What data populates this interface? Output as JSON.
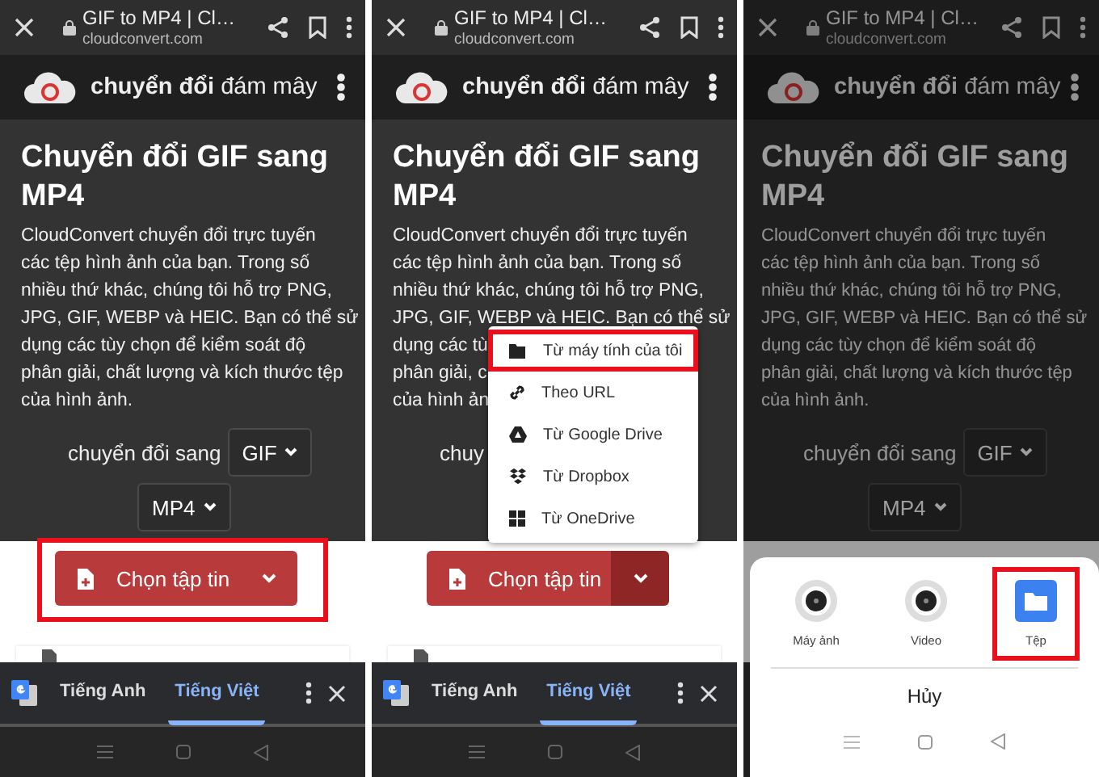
{
  "panels": [
    {
      "browser": {
        "title": "GIF to MP4 | Cl…",
        "url": "cloudconvert.com"
      },
      "brand": {
        "bold": "chuyển đổi",
        "rest": "đám mây"
      },
      "heading": [
        "Chuyển đổi GIF sang",
        "MP4"
      ],
      "paragraph": [
        "CloudConvert chuyển đổi trực tuyến",
        "các tệp hình ảnh của bạn. Trong số",
        "nhiều thứ khác, chúng tôi hỗ trợ PNG,",
        "JPG, GIF, WEBP và HEIC. Bạn có thể sử",
        "dụng các tùy chọn để kiểm soát độ",
        "phân giải, chất lượng và kích thước tệp",
        "của hình ảnh."
      ],
      "convert": {
        "label": "chuyển đổi sang",
        "from": "GIF",
        "to": "MP4"
      },
      "upload": {
        "label": "Chọn tập tin",
        "highlighted": true,
        "split_open": false
      },
      "translate_bar": {
        "languages": [
          {
            "label": "Tiếng Anh",
            "selected": false
          },
          {
            "label": "Tiếng Việt",
            "selected": true
          }
        ]
      }
    },
    {
      "browser": {
        "title": "GIF to MP4 | Cl…",
        "url": "cloudconvert.com"
      },
      "brand": {
        "bold": "chuyển đổi",
        "rest": "đám mây"
      },
      "heading": [
        "Chuyển đổi GIF sang",
        "MP4"
      ],
      "paragraph": [
        "CloudConvert chuyển đổi trực tuyến",
        "các tệp hình ảnh của bạn. Trong số",
        "nhiều thứ khác, chúng tôi hỗ trợ PNG,",
        "JPG, GIF, WEBP và HEIC. Bạn có thể sử",
        "dụng các tù",
        "phân giải, c",
        "của hình ản"
      ],
      "convert": {
        "label": "chuy"
      },
      "upload": {
        "label": "Chọn tập tin",
        "highlighted": false,
        "split_open": true
      },
      "menu": [
        {
          "label": "Từ máy tính của tôi",
          "highlighted": true
        },
        {
          "label": "Theo URL",
          "highlighted": false
        },
        {
          "label": "Từ Google Drive",
          "highlighted": false
        },
        {
          "label": "Từ Dropbox",
          "highlighted": false
        },
        {
          "label": "Từ OneDrive",
          "highlighted": false
        }
      ],
      "translate_bar": {
        "languages": [
          {
            "label": "Tiếng Anh",
            "selected": false
          },
          {
            "label": "Tiếng Việt",
            "selected": true
          }
        ]
      }
    },
    {
      "dimmed": true,
      "browser": {
        "title": "GIF to MP4 | Cl…",
        "url": "cloudconvert.com"
      },
      "brand": {
        "bold": "chuyển đổi",
        "rest": "đám mây"
      },
      "heading": [
        "Chuyển đổi GIF sang",
        "MP4"
      ],
      "paragraph": [
        "CloudConvert chuyển đổi trực tuyến",
        "các tệp hình ảnh của bạn. Trong số",
        "nhiều thứ khác, chúng tôi hỗ trợ PNG,",
        "JPG, GIF, WEBP và HEIC. Bạn có thể sử",
        "dụng các tùy chọn để kiểm soát độ",
        "phân giải, chất lượng và kích thước tệp",
        "của hình ảnh."
      ],
      "convert": {
        "label": "chuyển đổi sang",
        "from": "GIF",
        "to": "MP4"
      },
      "sheet": {
        "options": [
          {
            "label": "Máy ảnh",
            "highlighted": false
          },
          {
            "label": "Video",
            "highlighted": false
          },
          {
            "label": "Tệp",
            "highlighted": true
          }
        ],
        "cancel": "Hủy"
      }
    }
  ]
}
